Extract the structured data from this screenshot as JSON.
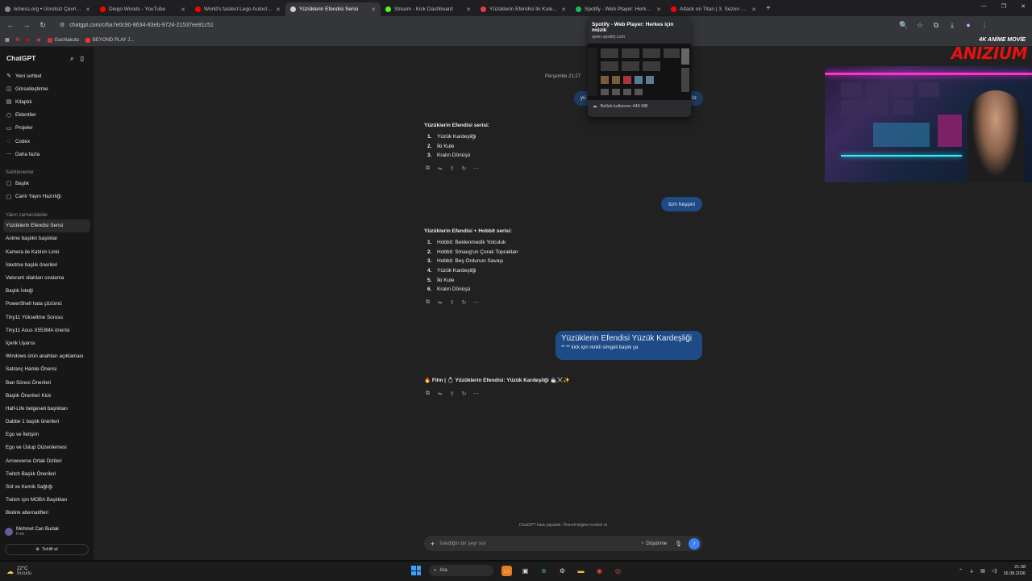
{
  "browser": {
    "tabs": [
      {
        "title": "lichess.org • Ücretsiz Çevrimiçi",
        "color": "#8a8a8a",
        "active": false
      },
      {
        "title": "Diego Woods - YouTube",
        "color": "#ff0000",
        "active": false
      },
      {
        "title": "World's fastest Lego Autoclicke",
        "color": "#ff0000",
        "active": false
      },
      {
        "title": "Yüzüklerin Efendisi Serisi",
        "color": "#d0d0d0",
        "active": true
      },
      {
        "title": "Stream - Kick Dashboard",
        "color": "#53fc18",
        "active": false
      },
      {
        "title": "Yüzüklerin Efendisi İki Kule izle",
        "color": "#e63946",
        "active": false
      },
      {
        "title": "Spotify - Web Player: Herkes i...",
        "color": "#1db954",
        "active": false
      },
      {
        "title": "Attack on Titan | 3. Sezon 16. B",
        "color": "#ff0000",
        "active": false
      }
    ],
    "url": "chatgpt.com/c/6a7e0c90-8634-83eb-9724-21537ee81c51",
    "bookmarks": [
      "Gachiakuta",
      "BEYOND PLAY J..."
    ],
    "hovercard": {
      "title": "Spotify - Web Player: Herkes için müzik",
      "url": "open.spotify.com",
      "memory": "Bellek kullanımı 449 MB"
    }
  },
  "sidebar": {
    "app_title": "ChatGPT",
    "top_items": [
      {
        "label": "Yeni sohbet",
        "icon": "edit-icon"
      },
      {
        "label": "Görselleştirme",
        "icon": "image-icon"
      },
      {
        "label": "Kitaplık",
        "icon": "library-icon"
      },
      {
        "label": "Eklentiler",
        "icon": "plugin-icon"
      },
      {
        "label": "Projeler",
        "icon": "folder-icon"
      },
      {
        "label": "Codex",
        "icon": "code-icon"
      },
      {
        "label": "Daha fazla",
        "icon": "more-icon"
      }
    ],
    "pinned_title": "Sabitlenenler",
    "pinned": [
      {
        "label": "Başlık",
        "icon": "chat-icon"
      },
      {
        "label": "Canlı Yayın Hazırlığı",
        "icon": "chat-icon"
      }
    ],
    "recent_title": "Yakın zamandakiler",
    "recent": [
      "Yüzüklerin Efendisi Serisi",
      "Anime başlıklı başlıklar",
      "Kamera ile Katılım Linki",
      "İsketme başlık önerileri",
      "Valorant silahları sıralama",
      "Başlık İsteği",
      "PowerShell hata çözümü",
      "Tiny11 Yükseltme Sorusu",
      "Tiny11 Asus X553MA önerisi",
      "İçerik Uyarısı",
      "Windows ürün anahtarı açıklaması",
      "Satranç Hamle Önerisi",
      "Ban Süresi Önerileri",
      "Başlık Önerileri Kick",
      "Half-Life belgeseli başlıkları",
      "Dabbe 1 başlık önerileri",
      "Ego ve İletişim",
      "Ego ve Üslup Düzenlemesi",
      "Arrowverse Ortak Dizileri",
      "Twitch Başlık Önerileri",
      "Süt ve Kemik Sağlığı",
      "Twitch için MOBA Başlıkları",
      "Biolink alternatifleri"
    ],
    "user": {
      "name": "Mehmet Can Budak",
      "plan": "Free"
    },
    "upgrade": "Teklifi al"
  },
  "chat": {
    "timestamp": "Perşembe 21:27",
    "hidden_bubble_left": "yü",
    "hidden_bubble_right": "öz",
    "resp1": {
      "title": "Yüzüklerin Efendisi serisi:",
      "items": [
        "Yüzük Kardeşliği",
        "İki Kule",
        "Kralın Dönüşü"
      ]
    },
    "user2": "tüm heşşini",
    "resp2": {
      "title": "Yüzüklerin Efendisi + Hobbit serisi:",
      "items": [
        "Hobbit: Beklenmedik Yolculuk",
        "Hobbit: Smaug'un Çorak Toprakları",
        "Hobbit: Beş Ordunun Savaşı",
        "Yüzük Kardeşliği",
        "İki Kule",
        "Kralın Dönüşü"
      ]
    },
    "user3_big": "Yüzüklerin Efendisi Yüzük Kardeşliği",
    "user3_small": "** ** kick için renkli simgeli başlık ya",
    "resp3": "🔥 Film | 💍 Yüzüklerin Efendisi: Yüzük Kardeşliği 🧙‍♂️⚔️✨",
    "resp3_prefix": "Film |",
    "disclaimer": "ChatGPT hata yapabilir. Önemli bilgileri kontrol et.",
    "input_placeholder": "İstediğin bir şeyi sor",
    "think_label": "Düşünme"
  },
  "overlay": {
    "logo_small": "4K ANİME MOVİE",
    "logo_big": "ANIZIUM"
  },
  "taskbar": {
    "weather_temp": "22°C",
    "weather_desc": "Bulutlu",
    "search_label": "Ara",
    "time": "21:38",
    "date": "16.08.2026"
  }
}
